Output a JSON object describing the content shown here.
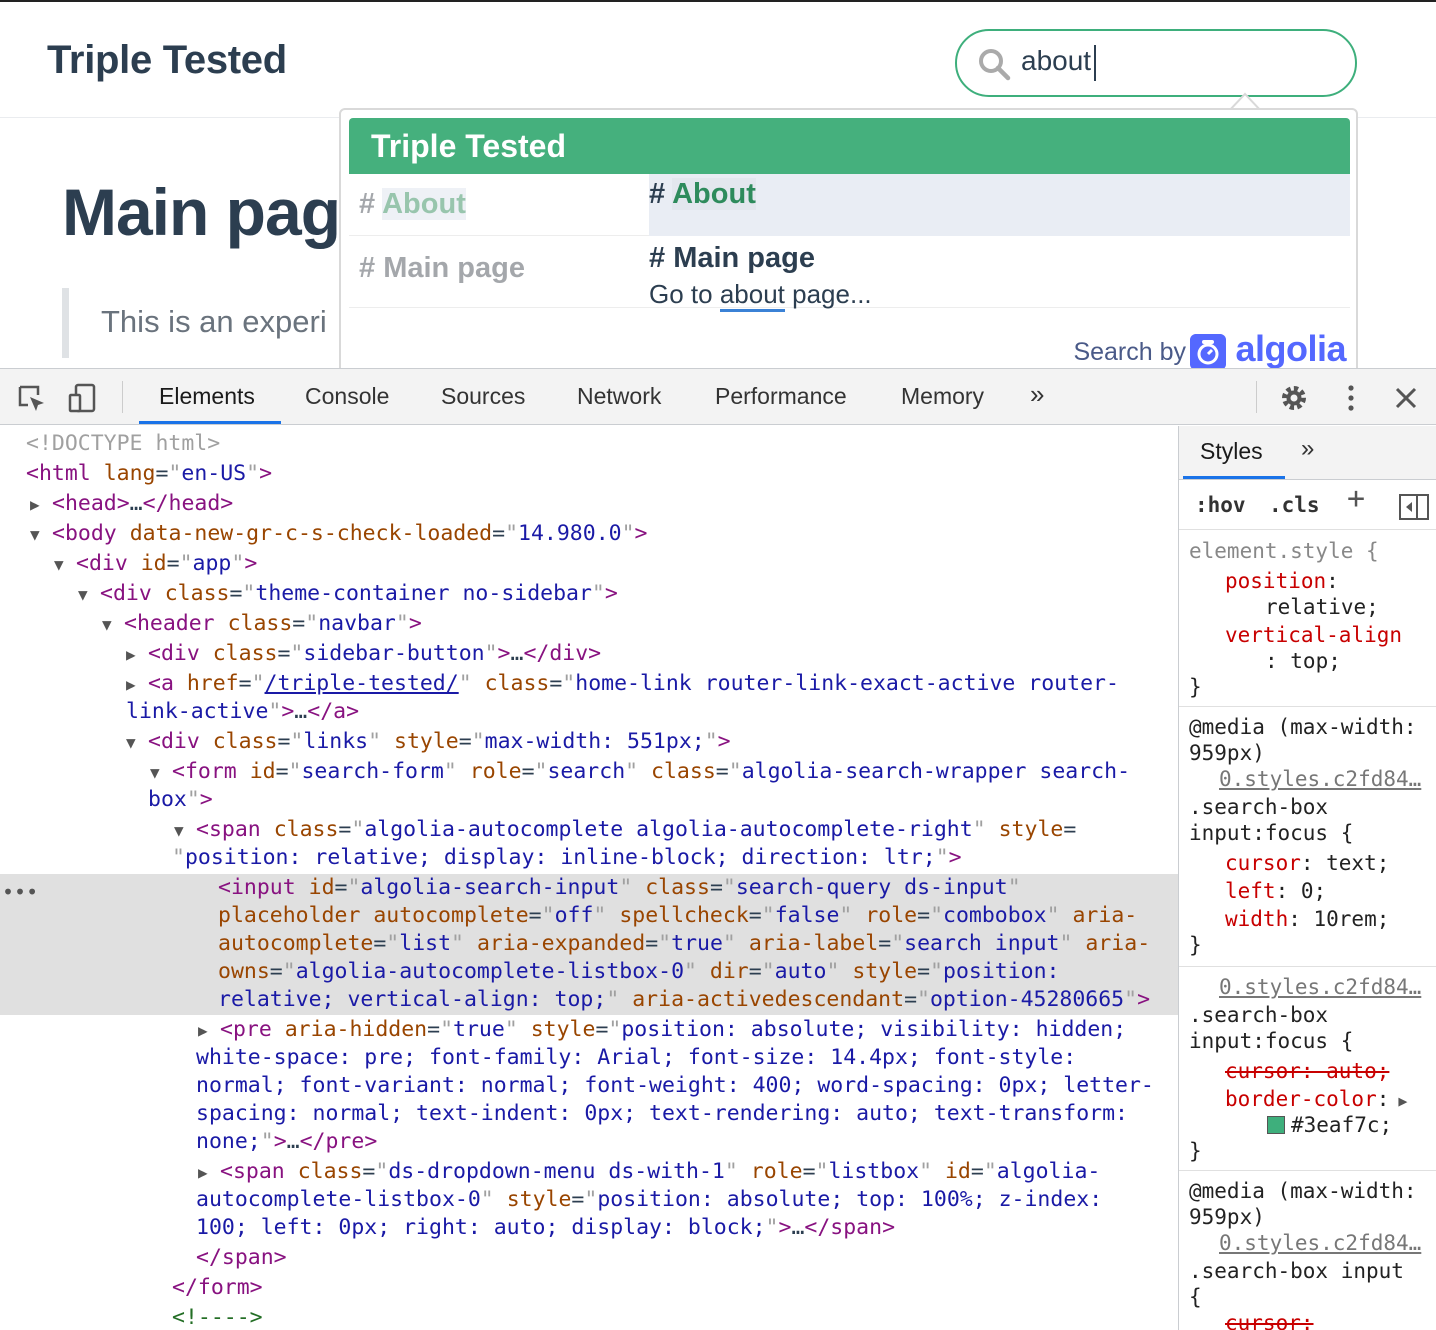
{
  "site": {
    "title": "Triple Tested",
    "search_value": "about",
    "main_heading": "Main pag",
    "quote_text": "This is an experi"
  },
  "dropdown": {
    "header": "Triple Tested",
    "results": [
      {
        "category_prefix": "# ",
        "category_hl": "About",
        "title_prefix": "# ",
        "title_hl": "About",
        "snippet": ""
      },
      {
        "category_prefix": "# ",
        "category_hl": "Main page",
        "title_prefix": "# ",
        "title_hl": "Main page",
        "snippet_before": "Go to ",
        "snippet_hl": "about",
        "snippet_after": " page..."
      }
    ],
    "search_by": "Search by",
    "algolia": "algolia"
  },
  "devtools": {
    "tabs": [
      "Elements",
      "Console",
      "Sources",
      "Network",
      "Performance",
      "Memory"
    ],
    "more_tabs": "»",
    "styles_tab": "Styles",
    "styles_more": "»",
    "hov": ":hov",
    "cls": ".cls",
    "plus": "+"
  },
  "colors": {
    "accent": "#3eaf7c",
    "dropdown_header": "#45b07d",
    "algolia": "#5468ff",
    "devtools_blue": "#1a73e8"
  },
  "icons": [
    "search-icon",
    "inspect-icon",
    "device-toolbar-icon",
    "gear-icon",
    "kebab-menu-icon",
    "close-icon",
    "toggle-sidebar-icon"
  ]
}
